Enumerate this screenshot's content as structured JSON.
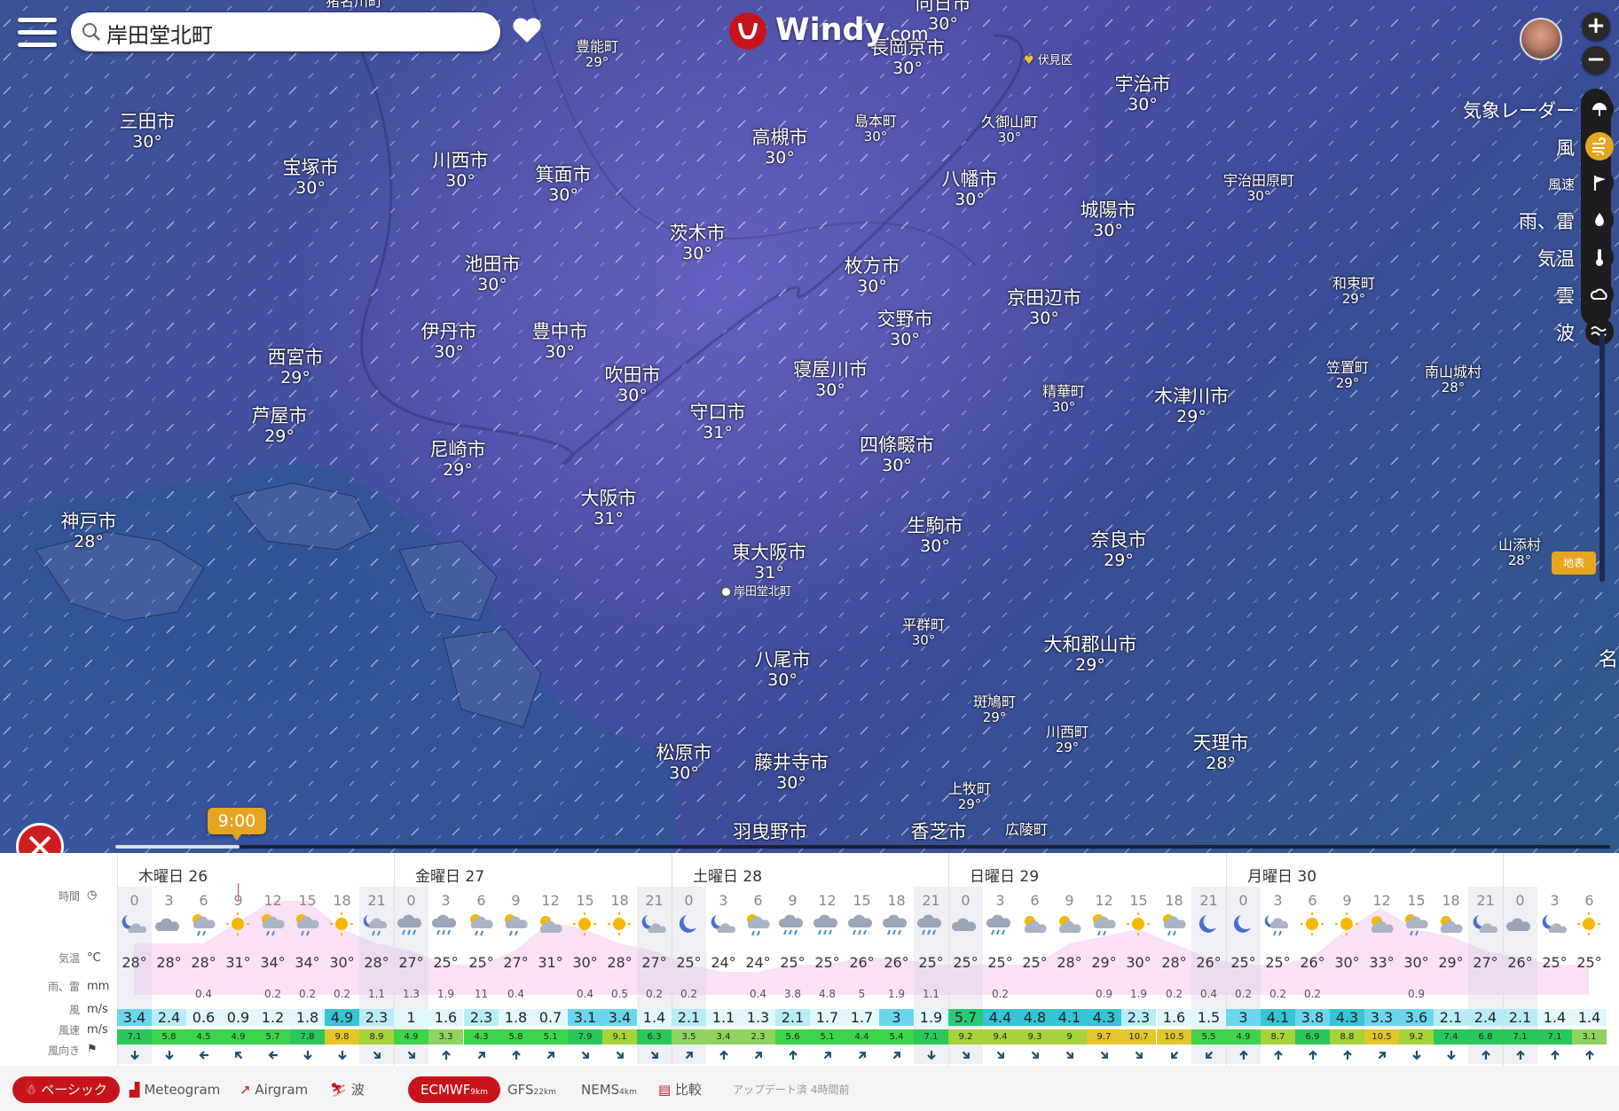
{
  "search": {
    "value": "岸田堂北町"
  },
  "logo": {
    "brand": "Windy",
    "domain": ".com"
  },
  "zoom": {
    "in": "+",
    "out": "−"
  },
  "layers": [
    {
      "label": "気象レーダー",
      "icon": "umbrella-icon",
      "active": false,
      "small": false
    },
    {
      "label": "風",
      "icon": "wind-icon",
      "active": true,
      "small": false
    },
    {
      "label": "風速",
      "icon": "flag-icon",
      "active": false,
      "small": true
    },
    {
      "label": "雨、雷",
      "icon": "drop-icon",
      "active": false,
      "small": false
    },
    {
      "label": "気温",
      "icon": "thermometer-icon",
      "active": false,
      "small": false
    },
    {
      "label": "雲",
      "icon": "cloud-icon",
      "active": false,
      "small": false
    },
    {
      "label": "波",
      "icon": "waves-icon",
      "active": false,
      "small": false
    }
  ],
  "surface_button": "地表",
  "right_edge_text": "名",
  "favorite_place": "伏見区",
  "pin_label": "岸田堂北町",
  "time_bubble": "9:00",
  "cities": [
    {
      "name": "猪名川町",
      "temp": "",
      "size": "small"
    },
    {
      "name": "豊能町",
      "temp": "29°",
      "size": "small"
    },
    {
      "name": "長岡京市",
      "temp": "30°",
      "size": "big"
    },
    {
      "name": "向日市",
      "temp": "30°",
      "size": "big"
    },
    {
      "name": "宇治市",
      "temp": "30°",
      "size": "big"
    },
    {
      "name": "三田市",
      "temp": "30°",
      "size": "big"
    },
    {
      "name": "宝塚市",
      "temp": "30°",
      "size": "big"
    },
    {
      "name": "川西市",
      "temp": "30°",
      "size": "big"
    },
    {
      "name": "箕面市",
      "temp": "30°",
      "size": "big"
    },
    {
      "name": "高槻市",
      "temp": "30°",
      "size": "big"
    },
    {
      "name": "島本町",
      "temp": "30°",
      "size": "small"
    },
    {
      "name": "久御山町",
      "temp": "30°",
      "size": "small"
    },
    {
      "name": "八幡市",
      "temp": "30°",
      "size": "big"
    },
    {
      "name": "城陽市",
      "temp": "30°",
      "size": "big"
    },
    {
      "name": "宇治田原町",
      "temp": "30°",
      "size": "small"
    },
    {
      "name": "茨木市",
      "temp": "30°",
      "size": "big"
    },
    {
      "name": "池田市",
      "temp": "30°",
      "size": "big"
    },
    {
      "name": "枚方市",
      "temp": "30°",
      "size": "big"
    },
    {
      "name": "京田辺市",
      "temp": "30°",
      "size": "big"
    },
    {
      "name": "和束町",
      "temp": "29°",
      "size": "small"
    },
    {
      "name": "交野市",
      "temp": "30°",
      "size": "big"
    },
    {
      "name": "伊丹市",
      "temp": "30°",
      "size": "big"
    },
    {
      "name": "豊中市",
      "temp": "30°",
      "size": "big"
    },
    {
      "name": "西宮市",
      "temp": "29°",
      "size": "big"
    },
    {
      "name": "吹田市",
      "temp": "30°",
      "size": "big"
    },
    {
      "name": "寝屋川市",
      "temp": "30°",
      "size": "big"
    },
    {
      "name": "精華町",
      "temp": "30°",
      "size": "small"
    },
    {
      "name": "木津川市",
      "temp": "29°",
      "size": "big"
    },
    {
      "name": "笠置町",
      "temp": "29°",
      "size": "small"
    },
    {
      "name": "南山城村",
      "temp": "28°",
      "size": "small"
    },
    {
      "name": "守口市",
      "temp": "31°",
      "size": "big"
    },
    {
      "name": "芦屋市",
      "temp": "29°",
      "size": "big"
    },
    {
      "name": "尼崎市",
      "temp": "29°",
      "size": "big"
    },
    {
      "name": "四條畷市",
      "temp": "30°",
      "size": "big"
    },
    {
      "name": "大阪市",
      "temp": "31°",
      "size": "big"
    },
    {
      "name": "神戸市",
      "temp": "28°",
      "size": "big"
    },
    {
      "name": "生駒市",
      "temp": "30°",
      "size": "big"
    },
    {
      "name": "奈良市",
      "temp": "29°",
      "size": "big"
    },
    {
      "name": "山添村",
      "temp": "28°",
      "size": "small"
    },
    {
      "name": "東大阪市",
      "temp": "31°",
      "size": "big"
    },
    {
      "name": "平群町",
      "temp": "30°",
      "size": "small"
    },
    {
      "name": "八尾市",
      "temp": "30°",
      "size": "big"
    },
    {
      "name": "大和郡山市",
      "temp": "29°",
      "size": "big"
    },
    {
      "name": "斑鳩町",
      "temp": "29°",
      "size": "small"
    },
    {
      "name": "川西町",
      "temp": "29°",
      "size": "small"
    },
    {
      "name": "松原市",
      "temp": "30°",
      "size": "big"
    },
    {
      "name": "藤井寺市",
      "temp": "30°",
      "size": "big"
    },
    {
      "name": "天理市",
      "temp": "28°",
      "size": "big"
    },
    {
      "name": "上牧町",
      "temp": "29°",
      "size": "small"
    },
    {
      "name": "羽曳野市",
      "temp": "",
      "size": "big"
    },
    {
      "name": "香芝市",
      "temp": "",
      "size": "big"
    },
    {
      "name": "広陵町",
      "temp": "",
      "size": "small"
    }
  ],
  "forecast": {
    "days": [
      "木曜日 26",
      "金曜日 27",
      "土曜日 28",
      "日曜日 29",
      "月曜日 30"
    ],
    "row_labels": {
      "time": "時間",
      "temp": "気温",
      "rain": "雨、雷",
      "wind": "風",
      "gust": "風速",
      "dir": "風向き"
    },
    "units": {
      "temp": "°C",
      "rain": "mm",
      "wind": "m/s",
      "gust": "m/s"
    },
    "hours": [
      "0",
      "3",
      "6",
      "9",
      "12",
      "15",
      "18",
      "21",
      "0",
      "3",
      "6",
      "9",
      "12",
      "15",
      "18",
      "21",
      "0",
      "3",
      "6",
      "9",
      "12",
      "15",
      "18",
      "21",
      "0",
      "3",
      "6",
      "9",
      "12",
      "15",
      "18",
      "21",
      "0",
      "3",
      "6",
      "9",
      "12",
      "15",
      "18",
      "21",
      "0",
      "3",
      "6"
    ],
    "icons": [
      "night-cloud",
      "cloud",
      "rain-sun",
      "sun",
      "rain-sun",
      "rain-sun",
      "sun",
      "rain-night",
      "rain",
      "rain",
      "rain-sun",
      "rain-sun",
      "cloud-sun",
      "sun",
      "sun",
      "night-cloud",
      "moon",
      "night-cloud",
      "rain-sun",
      "rain",
      "rain",
      "rain",
      "rain",
      "rain",
      "cloud",
      "rain",
      "cloud-sun",
      "cloud-sun",
      "rain-sun",
      "sun",
      "rain-sun",
      "moon",
      "moon",
      "rain-night",
      "sun",
      "sun",
      "cloud-sun",
      "rain-sun",
      "cloud-sun",
      "night-cloud",
      "cloud",
      "night-cloud",
      "sun"
    ],
    "temps": [
      "28°",
      "28°",
      "28°",
      "31°",
      "34°",
      "34°",
      "30°",
      "28°",
      "27°",
      "25°",
      "25°",
      "27°",
      "31°",
      "30°",
      "28°",
      "27°",
      "25°",
      "24°",
      "24°",
      "25°",
      "25°",
      "26°",
      "26°",
      "25°",
      "25°",
      "25°",
      "25°",
      "28°",
      "29°",
      "30°",
      "28°",
      "26°",
      "25°",
      "25°",
      "26°",
      "30°",
      "33°",
      "30°",
      "29°",
      "27°",
      "26°",
      "25°",
      "25°"
    ],
    "rain": [
      "",
      "",
      "0.4",
      "",
      "0.2",
      "0.2",
      "0.2",
      "1.1",
      "1.3",
      "1.9",
      "11",
      "0.4",
      "",
      "0.4",
      "0.5",
      "0.2",
      "0.2",
      "",
      "0.4",
      "3.8",
      "4.8",
      "5",
      "1.9",
      "1.1",
      "",
      "0.2",
      "",
      "",
      "0.9",
      "1.9",
      "0.2",
      "0.4",
      "0.2",
      "0.2",
      "0.2",
      "",
      "",
      "0.9",
      "",
      "",
      "",
      "",
      ""
    ],
    "wind": [
      "3.4",
      "2.4",
      "0.6",
      "0.9",
      "1.2",
      "1.8",
      "4.9",
      "2.3",
      "1",
      "1.6",
      "2.3",
      "1.8",
      "0.7",
      "3.1",
      "3.4",
      "1.4",
      "2.1",
      "1.1",
      "1.3",
      "2.1",
      "1.7",
      "1.7",
      "3",
      "1.9",
      "5.7",
      "4.4",
      "4.8",
      "4.1",
      "4.3",
      "2.3",
      "1.6",
      "1.5",
      "3",
      "4.1",
      "3.8",
      "4.3",
      "3.3",
      "3.6",
      "2.1",
      "2.4",
      "2.1",
      "1.4",
      "1.4"
    ],
    "gust": [
      "7.1",
      "5.8",
      "4.5",
      "4.9",
      "5.7",
      "7.8",
      "9.8",
      "8.9",
      "4.9",
      "3.3",
      "4.3",
      "5.8",
      "5.1",
      "7.9",
      "9.1",
      "6.3",
      "3.5",
      "3.4",
      "2.3",
      "5.6",
      "5.1",
      "4.4",
      "5.4",
      "7.1",
      "9.2",
      "9.4",
      "9.3",
      "9",
      "9.7",
      "10.7",
      "10.5",
      "5.5",
      "4.9",
      "8.7",
      "6.9",
      "8.8",
      "10.5",
      "9.2",
      "7.4",
      "6.8",
      "7.1",
      "7.1",
      "3.1"
    ],
    "dir_deg": [
      90,
      90,
      180,
      225,
      180,
      90,
      90,
      45,
      45,
      270,
      315,
      270,
      315,
      45,
      45,
      45,
      315,
      270,
      315,
      270,
      315,
      315,
      315,
      90,
      45,
      45,
      45,
      45,
      45,
      45,
      135,
      135,
      270,
      270,
      270,
      270,
      315,
      90,
      90,
      270,
      270,
      270,
      270
    ]
  },
  "footer": {
    "basic": "ベーシック",
    "meteogram": "Meteogram",
    "airgram": "Airgram",
    "waves": "波",
    "ecmwf": "ECMWF",
    "ecmwf_res": "9km",
    "gfs": "GFS",
    "gfs_res": "22km",
    "nems": "NEMS",
    "nems_res": "4km",
    "compare": "比較",
    "updated": "アップデート済 4時間前"
  },
  "colors": {
    "accent": "#e6a521",
    "brand_red": "#c7141c"
  }
}
